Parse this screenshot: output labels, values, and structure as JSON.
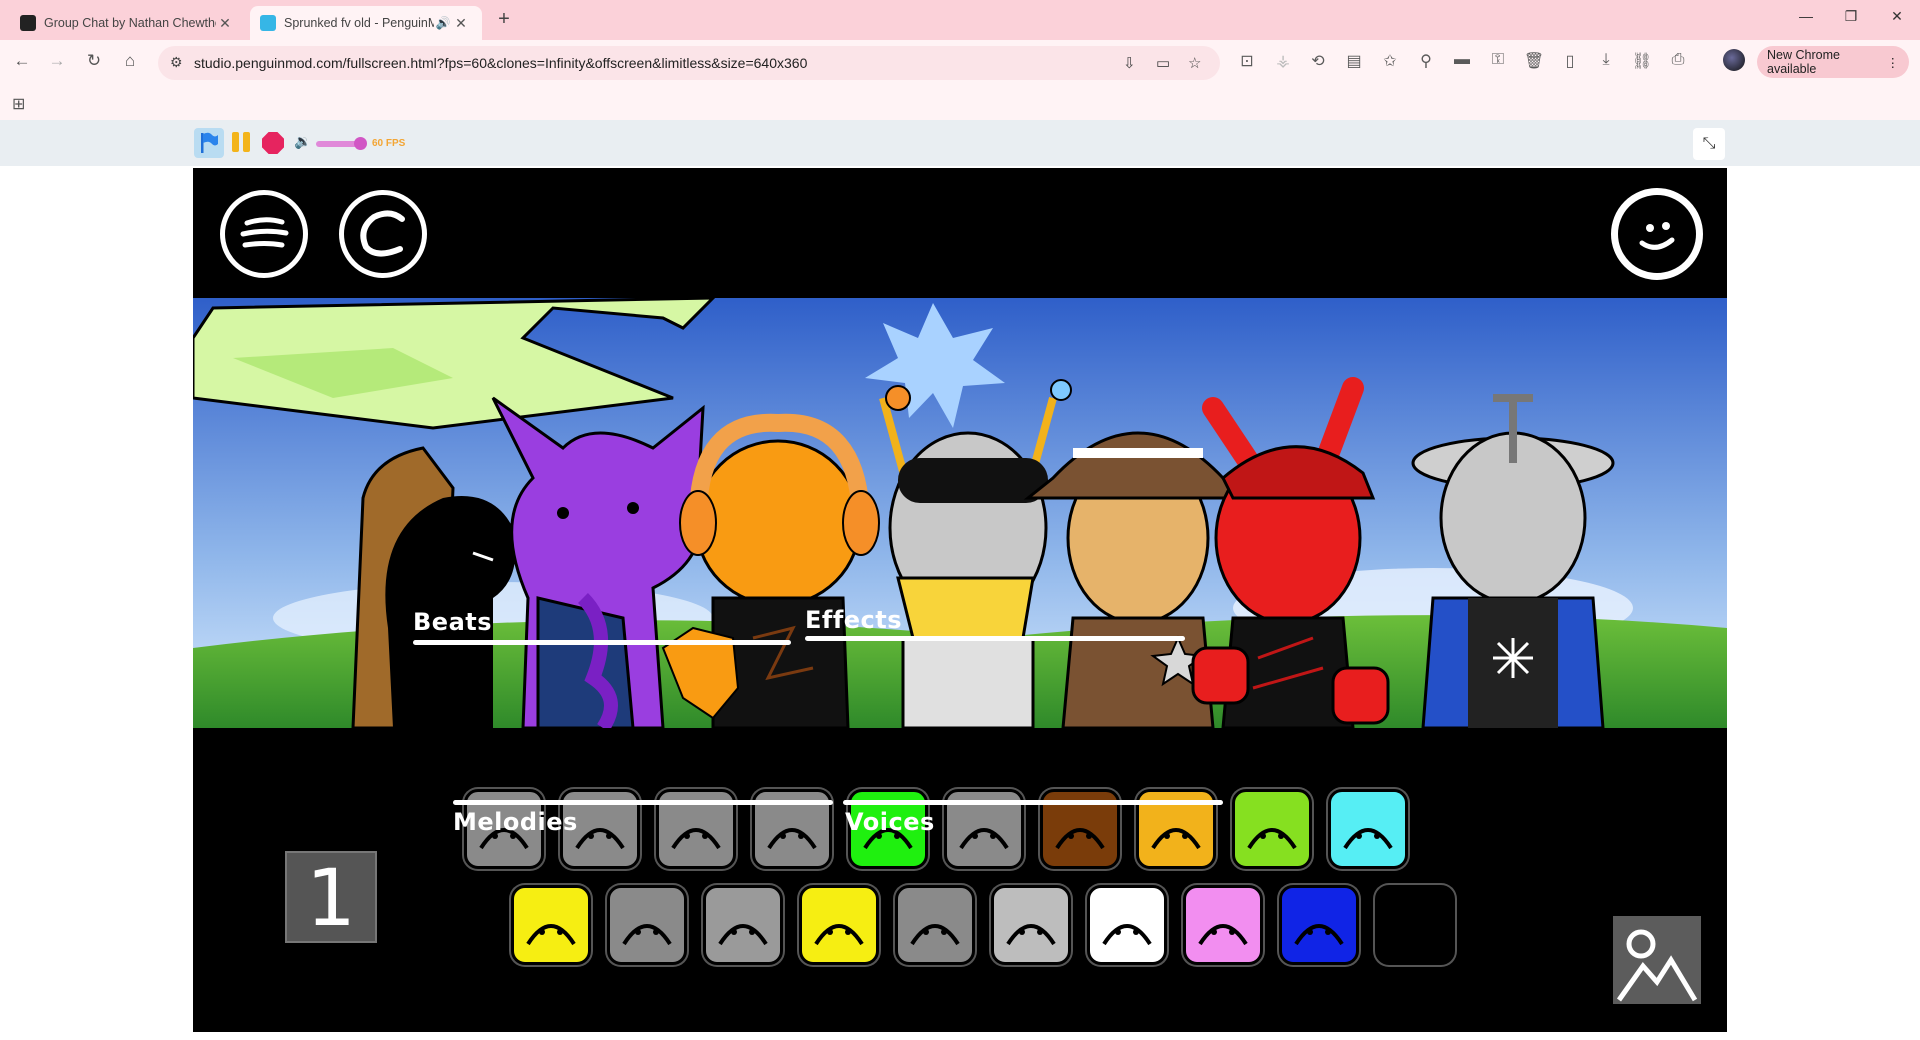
{
  "browser": {
    "tabs": [
      {
        "title": "Group Chat by Nathan Chewthe",
        "active": false
      },
      {
        "title": "Sprunked fv old - PenguinM",
        "active": true
      }
    ],
    "url": "studio.penguinmod.com/fullscreen.html?fps=60&clones=Infinity&offscreen&limitless&size=640x360",
    "update_label": "New Chrome available"
  },
  "player": {
    "fps_label": "60 FPS",
    "volume_fraction": 0.85
  },
  "stage": {
    "labels": {
      "beats": "Beats",
      "effects": "Effects",
      "melodies": "Melodies",
      "voices": "Voices"
    },
    "page_number": "1",
    "colors": {
      "background": "#000000",
      "sky_top": "#2f5fc9",
      "grass": "#3fa33a",
      "tree_leaves": "#d6f7a4"
    },
    "row1_icons": [
      {
        "name": "antenna-head-icon",
        "color": "#8a8a8a"
      },
      {
        "name": "spiky-hair-icon",
        "color": "#8a8a8a"
      },
      {
        "name": "cap-head-icon",
        "color": "#8a8a8a"
      },
      {
        "name": "headphone-icon",
        "color": "#8a8a8a"
      },
      {
        "name": "flower-icon",
        "color": "#1ff00f"
      },
      {
        "name": "cat-ears-icon",
        "color": "#8a8a8a"
      },
      {
        "name": "brown-hat-icon",
        "color": "#7a3c0a"
      },
      {
        "name": "black-blob-icon",
        "color": "#f2b21b"
      },
      {
        "name": "green-grass-icon",
        "color": "#86e020"
      },
      {
        "name": "cyan-minus-icon",
        "color": "#56eef4"
      }
    ],
    "row2_icons": [
      {
        "name": "yellow-star-icon",
        "color": "#f6ee12"
      },
      {
        "name": "bench-icon",
        "color": "#8a8a8a"
      },
      {
        "name": "green-tree-icon",
        "color": "#9a9a9a"
      },
      {
        "name": "yellow-antenna-icon",
        "color": "#f6ee12"
      },
      {
        "name": "lips-icon",
        "color": "#8a8a8a"
      },
      {
        "name": "tv-face-icon",
        "color": "#bdbdbd"
      },
      {
        "name": "white-cat-icon",
        "color": "#ffffff"
      },
      {
        "name": "pink-bow-icon",
        "color": "#f28ef0"
      },
      {
        "name": "blue-shield-icon",
        "color": "#1024e6"
      },
      {
        "name": "black-hat-icon",
        "color": "#000000"
      }
    ]
  }
}
